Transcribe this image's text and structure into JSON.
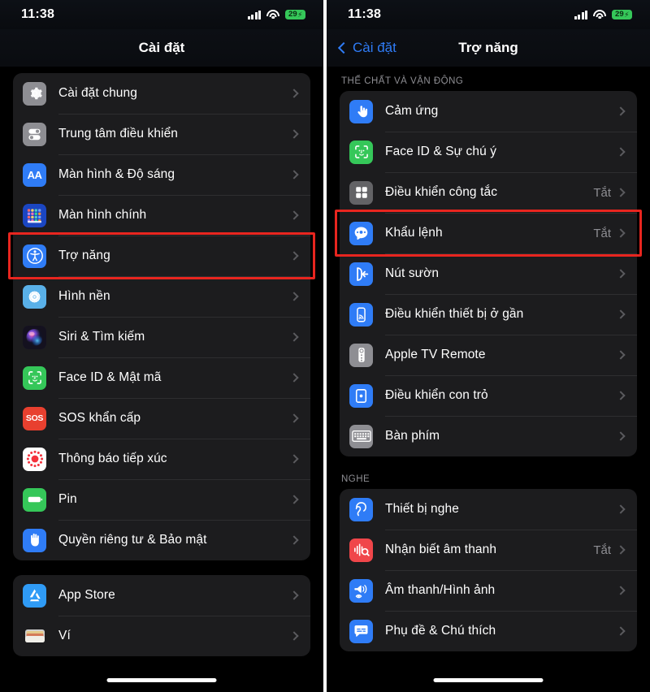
{
  "status_bar": {
    "time": "11:38",
    "battery_percent": "29",
    "battery_charging_glyph": "⚡",
    "battery_color": "#35c759",
    "signal_icon": "cellular-signal-icon",
    "wifi_icon": "wifi-icon"
  },
  "highlight_color": "#e8251f",
  "left_screen": {
    "nav": {
      "title": "Cài đặt"
    },
    "groups": [
      {
        "rows": [
          {
            "label": "Cài đặt chung",
            "icon": "gear-icon",
            "icon_bg": "#8e8e93",
            "value": ""
          },
          {
            "label": "Trung tâm điều khiển",
            "icon": "control-center-icon",
            "icon_bg": "#8e8e93",
            "value": ""
          },
          {
            "label": "Màn hình & Độ sáng",
            "icon": "display-aa-icon",
            "icon_bg": "#2f7cf6",
            "value": ""
          },
          {
            "label": "Màn hình chính",
            "icon": "home-screen-icon",
            "icon_bg": "#1b46c2",
            "value": ""
          },
          {
            "label": "Trợ năng",
            "icon": "accessibility-icon",
            "icon_bg": "#2f7cf6",
            "value": "",
            "highlighted": true
          },
          {
            "label": "Hình nền",
            "icon": "wallpaper-icon",
            "icon_bg": "#59b0e8",
            "value": ""
          },
          {
            "label": "Siri & Tìm kiếm",
            "icon": "siri-icon",
            "icon_bg": "#2a2a3a",
            "value": ""
          },
          {
            "label": "Face ID & Mật mã",
            "icon": "face-id-icon",
            "icon_bg": "#35c759",
            "value": ""
          },
          {
            "label": "SOS khẩn cấp",
            "icon": "sos-icon",
            "icon_bg": "#e8402f",
            "value": ""
          },
          {
            "label": "Thông báo tiếp xúc",
            "icon": "exposure-notification-icon",
            "icon_bg": "#ffffff",
            "value": ""
          },
          {
            "label": "Pin",
            "icon": "battery-icon",
            "icon_bg": "#35c759",
            "value": ""
          },
          {
            "label": "Quyền riêng tư & Bảo mật",
            "icon": "privacy-hand-icon",
            "icon_bg": "#2f7cf6",
            "value": ""
          }
        ]
      },
      {
        "rows": [
          {
            "label": "App Store",
            "icon": "app-store-icon",
            "icon_bg": "#2f9bf6",
            "value": ""
          },
          {
            "label": "Ví",
            "icon": "wallet-icon",
            "icon_bg": "#1c1c1e",
            "value": ""
          }
        ]
      }
    ]
  },
  "right_screen": {
    "nav": {
      "back_label": "Cài đặt",
      "title": "Trợ năng",
      "back_icon": "chevron-left-icon"
    },
    "sections": [
      {
        "label": "THỂ CHẤT VÀ VẬN ĐỘNG",
        "rows": [
          {
            "label": "Cảm ứng",
            "icon": "touch-icon",
            "icon_bg": "#2f7cf6",
            "value": ""
          },
          {
            "label": "Face ID & Sự chú ý",
            "icon": "face-id-icon",
            "icon_bg": "#35c759",
            "value": ""
          },
          {
            "label": "Điều khiển công tắc",
            "icon": "switch-control-icon",
            "icon_bg": "#636366",
            "value": "Tắt"
          },
          {
            "label": "Khẩu lệnh",
            "icon": "voice-control-icon",
            "icon_bg": "#2f7cf6",
            "value": "Tắt",
            "highlighted": true
          },
          {
            "label": "Nút sườn",
            "icon": "side-button-icon",
            "icon_bg": "#2f7cf6",
            "value": ""
          },
          {
            "label": "Điều khiển thiết bị ở gần",
            "icon": "nearby-device-icon",
            "icon_bg": "#2f7cf6",
            "value": ""
          },
          {
            "label": "Apple TV Remote",
            "icon": "apple-tv-remote-icon",
            "icon_bg": "#8e8e93",
            "value": ""
          },
          {
            "label": "Điều khiển con trỏ",
            "icon": "pointer-control-icon",
            "icon_bg": "#2f7cf6",
            "value": ""
          },
          {
            "label": "Bàn phím",
            "icon": "keyboard-icon",
            "icon_bg": "#8e8e93",
            "value": ""
          }
        ]
      },
      {
        "label": "NGHE",
        "rows": [
          {
            "label": "Thiết bị nghe",
            "icon": "hearing-device-icon",
            "icon_bg": "#2f7cf6",
            "value": ""
          },
          {
            "label": "Nhận biết âm thanh",
            "icon": "sound-recognition-icon",
            "icon_bg": "#f0464a",
            "value": "Tắt"
          },
          {
            "label": "Âm thanh/Hình ảnh",
            "icon": "audio-visual-icon",
            "icon_bg": "#2f7cf6",
            "value": ""
          },
          {
            "label": "Phụ đề & Chú thích",
            "icon": "subtitles-icon",
            "icon_bg": "#2f7cf6",
            "value": ""
          }
        ]
      }
    ]
  }
}
